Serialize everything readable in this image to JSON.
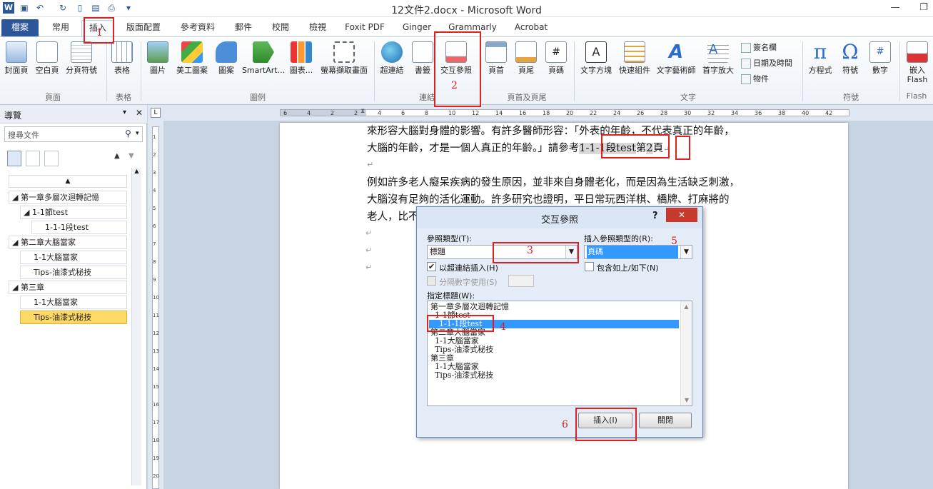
{
  "window": {
    "title": "12文件2.docx - Microsoft Word",
    "minimize": "—",
    "restore": "❐",
    "close": "✕"
  },
  "tabs": [
    {
      "label": "檔案"
    },
    {
      "label": "常用"
    },
    {
      "label": "插入"
    },
    {
      "label": "版面配置"
    },
    {
      "label": "參考資料"
    },
    {
      "label": "郵件"
    },
    {
      "label": "校閱"
    },
    {
      "label": "檢視"
    },
    {
      "label": "Foxit PDF"
    },
    {
      "label": "Ginger"
    },
    {
      "label": "Grammarly"
    },
    {
      "label": "Acrobat"
    }
  ],
  "ribbon": {
    "buttons": [
      {
        "label": "封面頁"
      },
      {
        "label": "空白頁"
      },
      {
        "label": "分頁符號"
      },
      {
        "label": "表格"
      },
      {
        "label": "圖片"
      },
      {
        "label": "美工圖案"
      },
      {
        "label": "圖案"
      },
      {
        "label": "SmartArt..."
      },
      {
        "label": "圖表..."
      },
      {
        "label": "螢幕擷取畫面"
      },
      {
        "label": "超連結"
      },
      {
        "label": "書籤"
      },
      {
        "label": "交互參照"
      },
      {
        "label": "頁首"
      },
      {
        "label": "頁尾"
      },
      {
        "label": "頁碼"
      },
      {
        "label": "文字方塊"
      },
      {
        "label": "快速組件"
      },
      {
        "label": "文字藝術師"
      },
      {
        "label": "首字放大"
      },
      {
        "label": "方程式"
      },
      {
        "label": "符號"
      },
      {
        "label": "數字"
      },
      {
        "label": "嵌入"
      }
    ],
    "small": [
      {
        "label": "簽名欄"
      },
      {
        "label": "日期及時間"
      },
      {
        "label": "物件"
      }
    ],
    "flash_sub": "Flash",
    "groups": [
      "頁面",
      "表格",
      "圖例",
      "連結",
      "頁首及頁尾",
      "文字",
      "符號",
      "Flash"
    ]
  },
  "nav": {
    "title": "導覽",
    "search_placeholder": "搜尋文件",
    "items": [
      {
        "label": "第一章多層次迴轉記憶"
      },
      {
        "label": "1-1節test"
      },
      {
        "label": "1-1-1段test"
      },
      {
        "label": "第二章大腦當家"
      },
      {
        "label": "1-1大腦當家"
      },
      {
        "label": "Tips-油漆式秘技"
      },
      {
        "label": "第三章"
      },
      {
        "label": "1-1大腦當家"
      },
      {
        "label": "Tips-油漆式秘技"
      }
    ]
  },
  "ruler": {
    "numbers": [
      "6",
      "4",
      "2",
      "2",
      "4",
      "6",
      "8",
      "10",
      "12",
      "14",
      "16",
      "18",
      "20",
      "22",
      "24",
      "26",
      "28",
      "30",
      "32",
      "34",
      "36",
      "38",
      "40",
      "42"
    ],
    "vnumbers": [
      "1",
      "2",
      "3",
      "4",
      "5",
      "6",
      "7",
      "8",
      "9",
      "10",
      "11",
      "12",
      "13",
      "14",
      "15",
      "16",
      "17",
      "18",
      "19",
      "20"
    ]
  },
  "document": {
    "line1": "來形容大腦對身體的影響。有許多醫師形容：「外表的年齡，不代表真正的年齡，",
    "line2a": "大腦的年齡，才是一個人真正的年齡。」請參考",
    "line2_field": "1-1-1段test",
    "line2b": "第",
    "line2_page": "2",
    "line2c": "頁",
    "para_mark": "↵",
    "line4": "例如許多老人癡呆疾病的發生原因，並非來自身體老化，而是因為生活缺乏刺激，",
    "line5": "大腦沒有足夠的活化運動。許多研究也證明，平日常玩西洋棋、橋牌、打麻將的",
    "line6": "老人，比不"
  },
  "dialog": {
    "title": "交互參照",
    "help": "?",
    "close": "✕",
    "ref_type_label": "參照類型(T):",
    "ref_type_value": "標題",
    "insert_ref_label": "插入參照類型的(R):",
    "insert_ref_value": "頁碼",
    "hyperlink_checkbox": "以超連結插入(H)",
    "hyperlink_checked": true,
    "above_below_checkbox": "包含如上/如下(N)",
    "separate_numbers": "分隔數字使用(S)",
    "heading_label": "指定標題(W):",
    "headings": [
      "第一章多層次迴轉記憶",
      "1-1節test",
      "1-1-1段test",
      "第二章大腦當家",
      "1-1大腦當家",
      "Tips-油漆式秘技",
      "第三章",
      "1-1大腦當家",
      "Tips-油漆式秘技"
    ],
    "selected_heading": "1-1-1段test",
    "insert_button": "插入(I)",
    "close_button": "關閉"
  },
  "annotations": [
    "1",
    "2",
    "3",
    "4",
    "5",
    "6"
  ],
  "colors": {
    "accent": "#2b579a",
    "annotation": "#e02020",
    "selection": "#3399ff",
    "nav_highlight": "#ffd966"
  }
}
